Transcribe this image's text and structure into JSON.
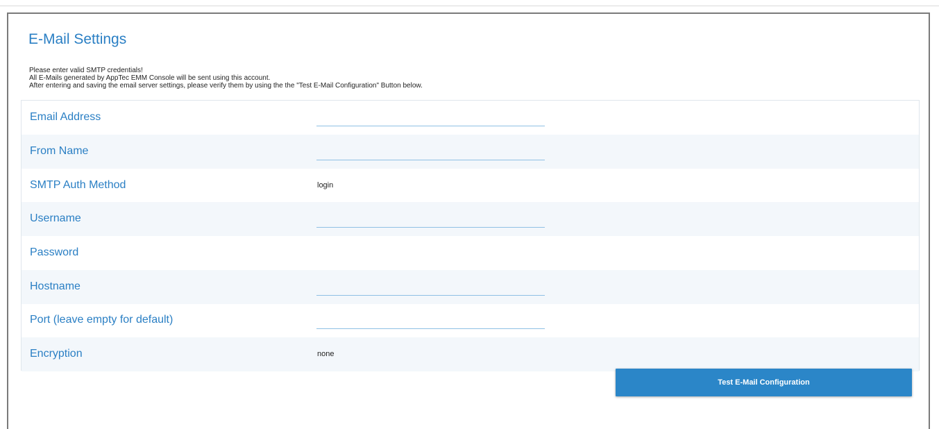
{
  "page": {
    "title": "E-Mail Settings",
    "intro_lines": [
      "Please enter valid SMTP credentials!",
      "All E-Mails generated by AppTec EMM Console will be sent using this account.",
      "After entering and saving the email server settings, please verify them by using the the \"Test E-Mail Configuration\" Button below."
    ]
  },
  "form": {
    "email_address": {
      "label": "Email Address",
      "value": ""
    },
    "from_name": {
      "label": "From Name",
      "value": ""
    },
    "smtp_auth_method": {
      "label": "SMTP Auth Method",
      "value": "login"
    },
    "username": {
      "label": "Username",
      "value": ""
    },
    "password": {
      "label": "Password"
    },
    "hostname": {
      "label": "Hostname",
      "value": ""
    },
    "port": {
      "label": "Port (leave empty for default)",
      "value": ""
    },
    "encryption": {
      "label": "Encryption",
      "value": "none"
    }
  },
  "actions": {
    "test_button_label": "Test E-Mail Configuration"
  },
  "colors": {
    "accent": "#2a7fc4",
    "button": "#2b86c8",
    "row_alt": "#f3f7fb"
  }
}
